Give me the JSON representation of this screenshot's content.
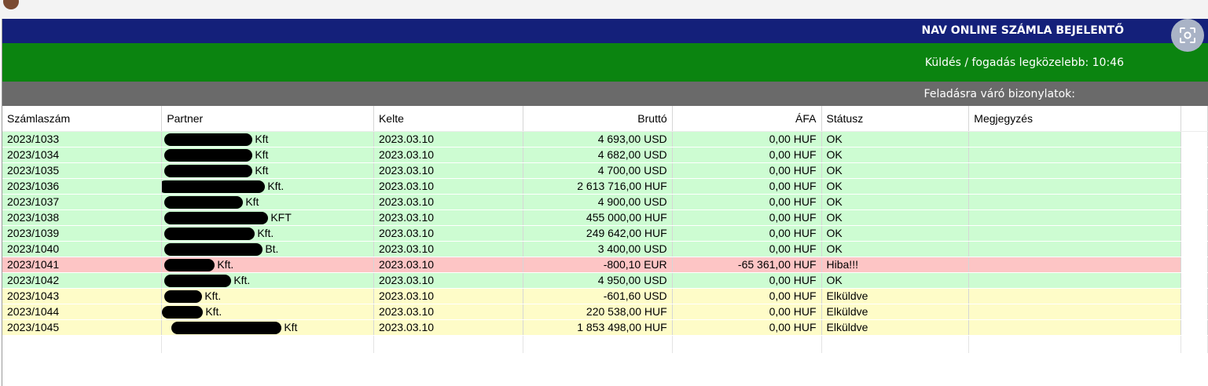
{
  "header": {
    "title": "NAV ONLINE SZÁMLA BEJELENTŐ",
    "next_send": "Küldés / fogadás legközelebb: 10:46",
    "pending_label": "Feladásra váró bizonylatok:"
  },
  "table": {
    "columns": [
      "Számlaszám",
      "Partner",
      "Kelte",
      "Bruttó",
      "ÁFA",
      "Státusz",
      "Megjegyzés"
    ],
    "rows": [
      {
        "id": "2023/1033",
        "partner": "Kft",
        "date": "2023.03.10",
        "gross": "4 693,00 USD",
        "vat": "0,00 HUF",
        "status": "OK",
        "note": ""
      },
      {
        "id": "2023/1034",
        "partner": "Kft",
        "date": "2023.03.10",
        "gross": "4 682,00 USD",
        "vat": "0,00 HUF",
        "status": "OK",
        "note": ""
      },
      {
        "id": "2023/1035",
        "partner": "Kft",
        "date": "2023.03.10",
        "gross": "4 700,00 USD",
        "vat": "0,00 HUF",
        "status": "OK",
        "note": ""
      },
      {
        "id": "2023/1036",
        "partner": "Kft.",
        "date": "2023.03.10",
        "gross": "2 613 716,00 HUF",
        "vat": "0,00 HUF",
        "status": "OK",
        "note": ""
      },
      {
        "id": "2023/1037",
        "partner": "Kft",
        "date": "2023.03.10",
        "gross": "4 900,00 USD",
        "vat": "0,00 HUF",
        "status": "OK",
        "note": ""
      },
      {
        "id": "2023/1038",
        "partner": "KFT",
        "date": "2023.03.10",
        "gross": "455 000,00 HUF",
        "vat": "0,00 HUF",
        "status": "OK",
        "note": ""
      },
      {
        "id": "2023/1039",
        "partner": "Kft.",
        "date": "2023.03.10",
        "gross": "249 642,00 HUF",
        "vat": "0,00 HUF",
        "status": "OK",
        "note": ""
      },
      {
        "id": "2023/1040",
        "partner": "Bt.",
        "date": "2023.03.10",
        "gross": "3 400,00 USD",
        "vat": "0,00 HUF",
        "status": "OK",
        "note": ""
      },
      {
        "id": "2023/1041",
        "partner": "Kft.",
        "date": "2023.03.10",
        "gross": "-800,10 EUR",
        "vat": "-65 361,00 HUF",
        "status": "Hiba!!!",
        "note": ""
      },
      {
        "id": "2023/1042",
        "partner": "Kft.",
        "date": "2023.03.10",
        "gross": "4 950,00 USD",
        "vat": "0,00 HUF",
        "status": "OK",
        "note": ""
      },
      {
        "id": "2023/1043",
        "partner": "Kft.",
        "date": "2023.03.10",
        "gross": "-601,60 USD",
        "vat": "0,00 HUF",
        "status": "Elküldve",
        "note": ""
      },
      {
        "id": "2023/1044",
        "partner": "Kft.",
        "date": "2023.03.10",
        "gross": "220 538,00 HUF",
        "vat": "0,00 HUF",
        "status": "Elküldve",
        "note": ""
      },
      {
        "id": "2023/1045",
        "partner": "Kft",
        "date": "2023.03.10",
        "gross": "1 853 498,00 HUF",
        "vat": "0,00 HUF",
        "status": "Elküldve",
        "note": ""
      }
    ]
  },
  "colors": {
    "title_bar": "#14207a",
    "info_bar": "#0b8410",
    "section_bar": "#6a6a6a",
    "row_ok": "#cdfcd2",
    "row_error": "#fdc5c5",
    "row_sent": "#fefcc8"
  },
  "icons": {
    "lens": "visual-search-icon"
  }
}
